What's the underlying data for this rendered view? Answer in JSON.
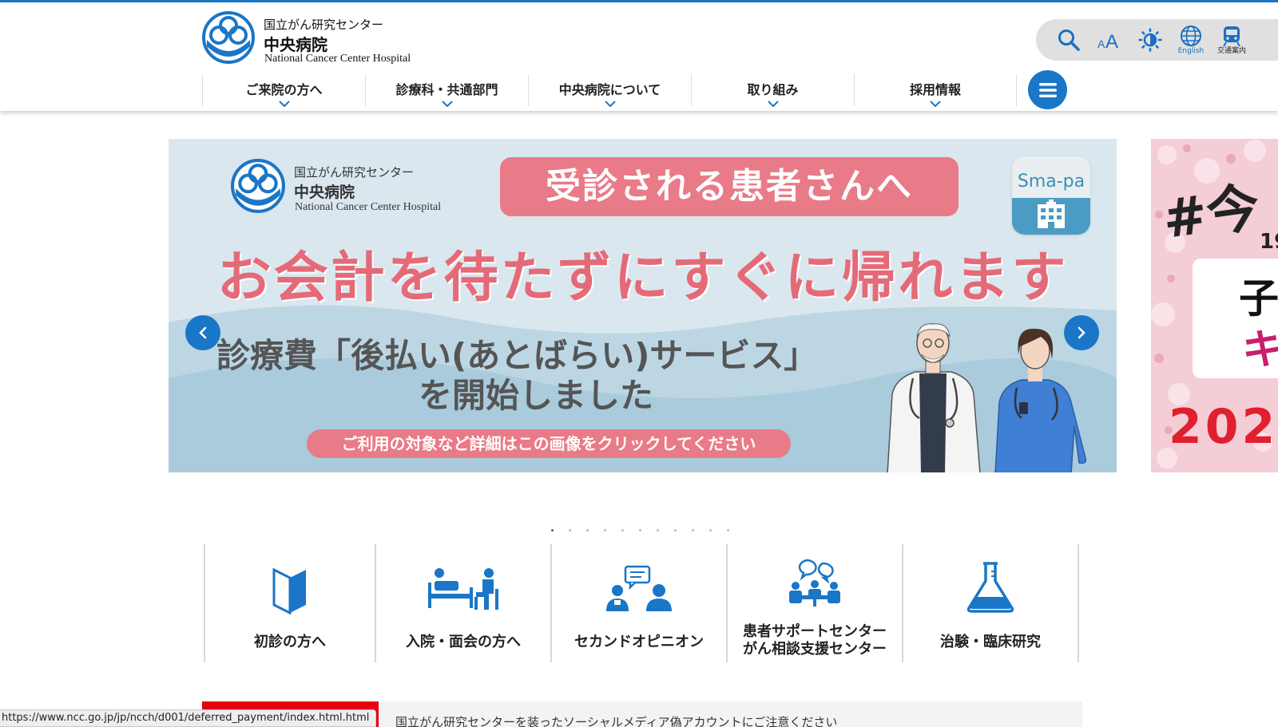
{
  "header": {
    "logo": {
      "line1": "国立がん研究センター",
      "line2": "中央病院",
      "line3": "National Cancer Center Hospital"
    },
    "tools": {
      "search_icon": "search-icon",
      "font_size_label": "AA",
      "contrast_icon": "brightness-icon",
      "english_label": "English",
      "access_label": "交通案内"
    },
    "nav": [
      {
        "label": "ご来院の方へ"
      },
      {
        "label": "診療科・共通部門"
      },
      {
        "label": "中央病院について"
      },
      {
        "label": "取り組み"
      },
      {
        "label": "採用情報"
      }
    ],
    "menu_icon": "hamburger-menu-icon"
  },
  "carousel": {
    "slide": {
      "logo": {
        "line1": "国立がん研究センター",
        "line2": "中央病院",
        "line3": "National Cancer Center Hospital"
      },
      "pill": "受診される患者さんへ",
      "app_name": "Sma-pa",
      "headline": "お会計を待たずにすぐに帰れます",
      "sub1": "診療費「後払い(あとばらい)サービス」",
      "sub2": "を開始しました",
      "cta": "ご利用の対象など詳細はこの画像をクリックしてください"
    },
    "next_slide": {
      "text1": "#今",
      "text2": "19",
      "text3": "子",
      "text4": "キ",
      "text5": "202"
    },
    "dots_count": 11,
    "active_dot": 0
  },
  "quick_links": [
    {
      "label": "初診の方へ",
      "icon": "beginner-mark-icon"
    },
    {
      "label": "入院・面会の方へ",
      "icon": "hospital-bed-visit-icon"
    },
    {
      "label": "セカンドオピニオン",
      "icon": "consultation-icon"
    },
    {
      "label1": "患者サポートセンター",
      "label2": "がん相談支援センター",
      "icon": "support-meeting-icon"
    },
    {
      "label": "治験・臨床研究",
      "icon": "flask-icon"
    }
  ],
  "notice": {
    "link": "国立がん研究センターを装ったソーシャルメディア偽アカウントにご注意ください"
  },
  "status_bar": {
    "url": "https://www.ncc.go.jp/jp/ncch/d001/deferred_payment/index.html.html"
  },
  "colors": {
    "primary": "#1a76c6",
    "pink": "#e97a87",
    "alert": "#e60012"
  }
}
